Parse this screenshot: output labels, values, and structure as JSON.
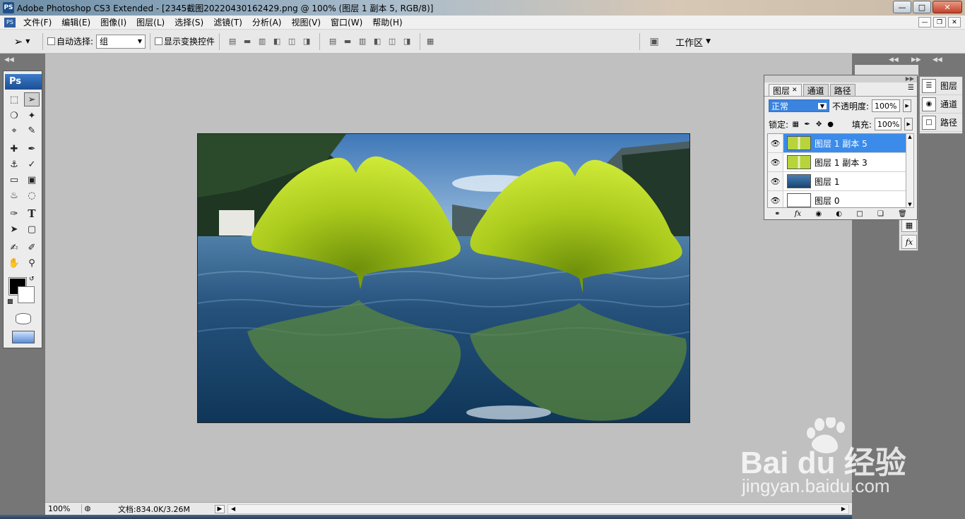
{
  "window": {
    "app_icon": "PS",
    "title": "Adobe Photoshop CS3 Extended - [2345截图20220430162429.png @ 100% (图层 1 副本 5, RGB/8)]",
    "controls": [
      "minimize",
      "maximize",
      "close"
    ]
  },
  "menubar": {
    "items": [
      {
        "label": "文件(F)"
      },
      {
        "label": "编辑(E)"
      },
      {
        "label": "图像(I)"
      },
      {
        "label": "图层(L)"
      },
      {
        "label": "选择(S)"
      },
      {
        "label": "滤镜(T)"
      },
      {
        "label": "分析(A)"
      },
      {
        "label": "视图(V)"
      },
      {
        "label": "窗口(W)"
      },
      {
        "label": "帮助(H)"
      }
    ]
  },
  "options": {
    "auto_select_label": "自动选择:",
    "auto_select_value": "组",
    "show_transform_label": "显示变换控件",
    "workspace_label": "工作区"
  },
  "toolbox": {
    "badge": "Ps",
    "tools": [
      "marquee-tool",
      "move-tool",
      "lasso-tool",
      "magic-wand-tool",
      "crop-tool",
      "slice-tool",
      "healing-brush-tool",
      "brush-tool",
      "clone-stamp-tool",
      "history-brush-tool",
      "eraser-tool",
      "gradient-tool",
      "blur-tool",
      "dodge-tool",
      "pen-tool",
      "type-tool",
      "path-selection-tool",
      "shape-tool",
      "notes-tool",
      "eyedropper-tool",
      "hand-tool",
      "zoom-tool"
    ],
    "foreground_color": "#000000",
    "background_color": "#ffffff",
    "text_tool_glyph": "T"
  },
  "status": {
    "zoom": "100%",
    "doc_size": "文档:834.0K/3.26M"
  },
  "dock": {
    "items": [
      {
        "label": "图层",
        "icon": "layers-icon"
      },
      {
        "label": "通道",
        "icon": "channels-icon"
      },
      {
        "label": "路径",
        "icon": "paths-icon"
      }
    ]
  },
  "layers_panel": {
    "tabs": [
      {
        "label": "图层",
        "closable": true
      },
      {
        "label": "通道"
      },
      {
        "label": "路径"
      }
    ],
    "blend_mode": "正常",
    "opacity_label": "不透明度:",
    "opacity_value": "100%",
    "lock_label": "锁定:",
    "fill_label": "填充:",
    "fill_value": "100%",
    "layers": [
      {
        "name": "图层 1 副本 5",
        "selected": true,
        "thumb": "leaf"
      },
      {
        "name": "图层 1 副本 3",
        "selected": false,
        "thumb": "leaf"
      },
      {
        "name": "图层 1",
        "selected": false,
        "thumb": "lake"
      },
      {
        "name": "图层 0",
        "selected": false,
        "thumb": "blank"
      }
    ]
  },
  "watermark": {
    "brand": "Bai du 经验",
    "url": "jingyan.baidu.com"
  }
}
